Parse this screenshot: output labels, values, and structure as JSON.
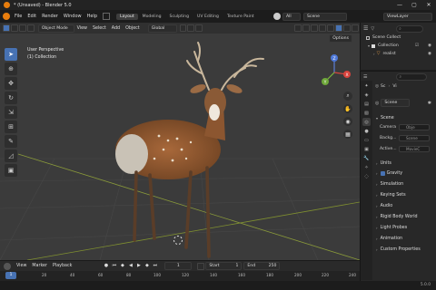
{
  "window": {
    "title": "* (Unsaved) - Blender 5.0",
    "controls": [
      "—",
      "▢",
      "✕"
    ]
  },
  "menubar": {
    "items": [
      "File",
      "Edit",
      "Render",
      "Window",
      "Help"
    ]
  },
  "workspaces": {
    "active": "Layout",
    "items": [
      "Modeling",
      "Sculpting",
      "UV Editing",
      "Texture Paint"
    ]
  },
  "scene_selector": {
    "label": "Scene"
  },
  "view_layer_selector": {
    "label": "ViewLayer"
  },
  "viewport": {
    "mode": "Object Mode",
    "menus": [
      "View",
      "Select",
      "Add",
      "Object"
    ],
    "transform_orientation": "Global",
    "options_label": "Options",
    "overlay_perspective": "User Perspective",
    "overlay_collection": "(1) Collection",
    "axis_labels": {
      "x": "X",
      "y": "Y",
      "z": "Z"
    }
  },
  "timeline": {
    "menus": [
      "View",
      "Marker",
      "Playback"
    ],
    "current_frame": "1",
    "start_label": "Start",
    "start_value": "1",
    "end_label": "End",
    "end_value": "250",
    "ruler_ticks": [
      "1",
      "20",
      "40",
      "60",
      "80",
      "100",
      "120",
      "140",
      "160",
      "180",
      "200",
      "220",
      "240"
    ],
    "current_marker": "1"
  },
  "status": {
    "version": "5.0.0"
  },
  "outliner": {
    "title": "Scene Collect",
    "items": [
      {
        "label": "Collection",
        "level": 0
      },
      {
        "label": "realist",
        "level": 1
      }
    ]
  },
  "properties": {
    "breadcrumb_a": "Sc",
    "breadcrumb_b": "Vi",
    "scene_field": "Scene",
    "panel_title": "Scene",
    "camera_label": "Camera",
    "camera_value": "Obje",
    "background_label": "Backg...",
    "background_value": "Scene",
    "active_label": "Active...",
    "active_value": "MovieC",
    "sections": [
      "Units",
      "Gravity",
      "Simulation",
      "Keying Sets",
      "Audio",
      "Rigid Body World",
      "Light Probes",
      "Animation",
      "Custom Properties"
    ]
  },
  "colors": {
    "accent": "#4772b3",
    "viewport_bg": "#3b3b3b",
    "panel_bg": "#282828"
  }
}
